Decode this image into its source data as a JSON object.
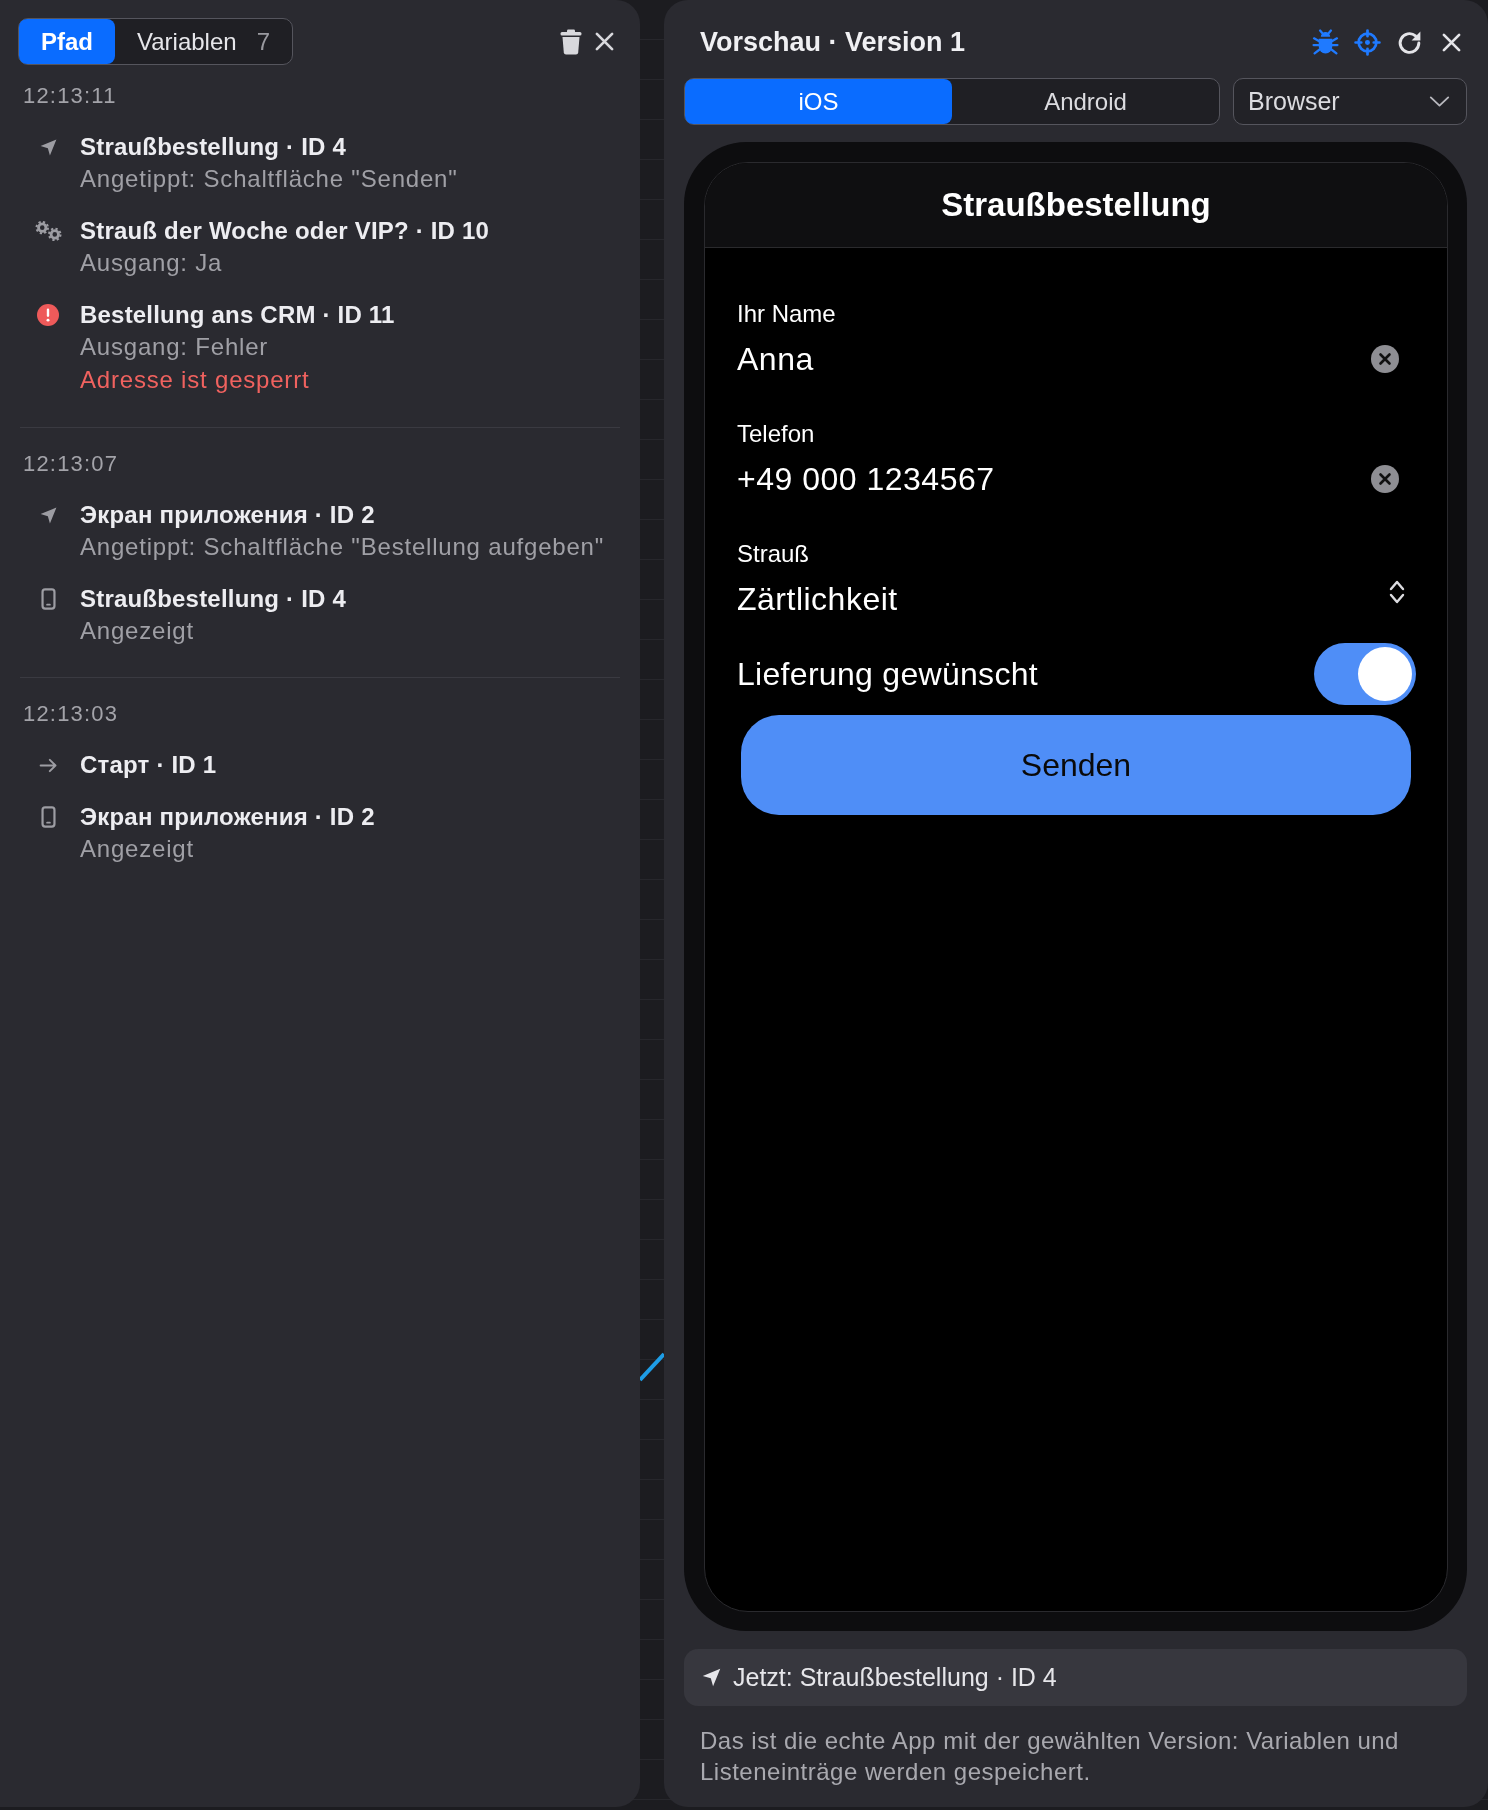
{
  "path_panel": {
    "tabs": [
      {
        "label": "Pfad",
        "selected": true
      },
      {
        "label": "Variablen",
        "count": "7",
        "selected": false
      }
    ],
    "groups": [
      {
        "time": "12:13:11",
        "entries": [
          {
            "kind": "tap",
            "title": "Straußbestellung · ID 4",
            "details": [
              "Angetippt: Schaltfläche \"Senden\""
            ]
          },
          {
            "kind": "logic",
            "title": "Strauß der Woche oder VIP? · ID 10",
            "details": [
              "Ausgang: Ja"
            ]
          },
          {
            "kind": "error",
            "title": "Bestellung ans CRM · ID 11",
            "details": [
              "Ausgang: Fehler"
            ],
            "error": "Adresse ist gesperrt"
          }
        ]
      },
      {
        "time": "12:13:07",
        "entries": [
          {
            "kind": "tap",
            "title": "Экран приложения · ID 2",
            "details": [
              "Angetippt: Schaltfläche \"Bestellung aufgeben\""
            ]
          },
          {
            "kind": "screen",
            "title": "Straußbestellung · ID 4",
            "details": [
              "Angezeigt"
            ]
          }
        ]
      },
      {
        "time": "12:13:03",
        "entries": [
          {
            "kind": "start",
            "title": "Старт · ID 1"
          },
          {
            "kind": "screen",
            "title": "Экран приложения · ID 2",
            "details": [
              "Angezeigt"
            ]
          }
        ]
      }
    ]
  },
  "preview_panel": {
    "title": "Vorschau · Version 1",
    "toolbar": [
      {
        "kind": "debug",
        "on": true
      },
      {
        "kind": "inspect",
        "on": true
      },
      {
        "kind": "reload",
        "on": false
      },
      {
        "kind": "close",
        "on": false
      }
    ],
    "platforms": [
      {
        "label": "iOS",
        "selected": true
      },
      {
        "label": "Android",
        "selected": false
      }
    ],
    "browser_select": {
      "value": "Browser"
    },
    "screen": {
      "title": "Straußbestellung",
      "fields": [
        {
          "kind": "text",
          "label": "Ihr Name",
          "value": "Anna"
        },
        {
          "kind": "text",
          "label": "Telefon",
          "value": "+49 000 1234567"
        },
        {
          "kind": "select",
          "label": "Strauß",
          "value": "Zärtlichkeit"
        },
        {
          "kind": "toggle",
          "label": "Lieferung gewünscht",
          "on": true
        }
      ],
      "button": "Senden"
    },
    "current_step": {
      "kind": "tap",
      "text": "Jetzt: Straußbestellung · ID 4"
    },
    "note": "Das ist die echte App mit der gewählten Version: Variablen und Listeneinträge werden gespeichert."
  }
}
